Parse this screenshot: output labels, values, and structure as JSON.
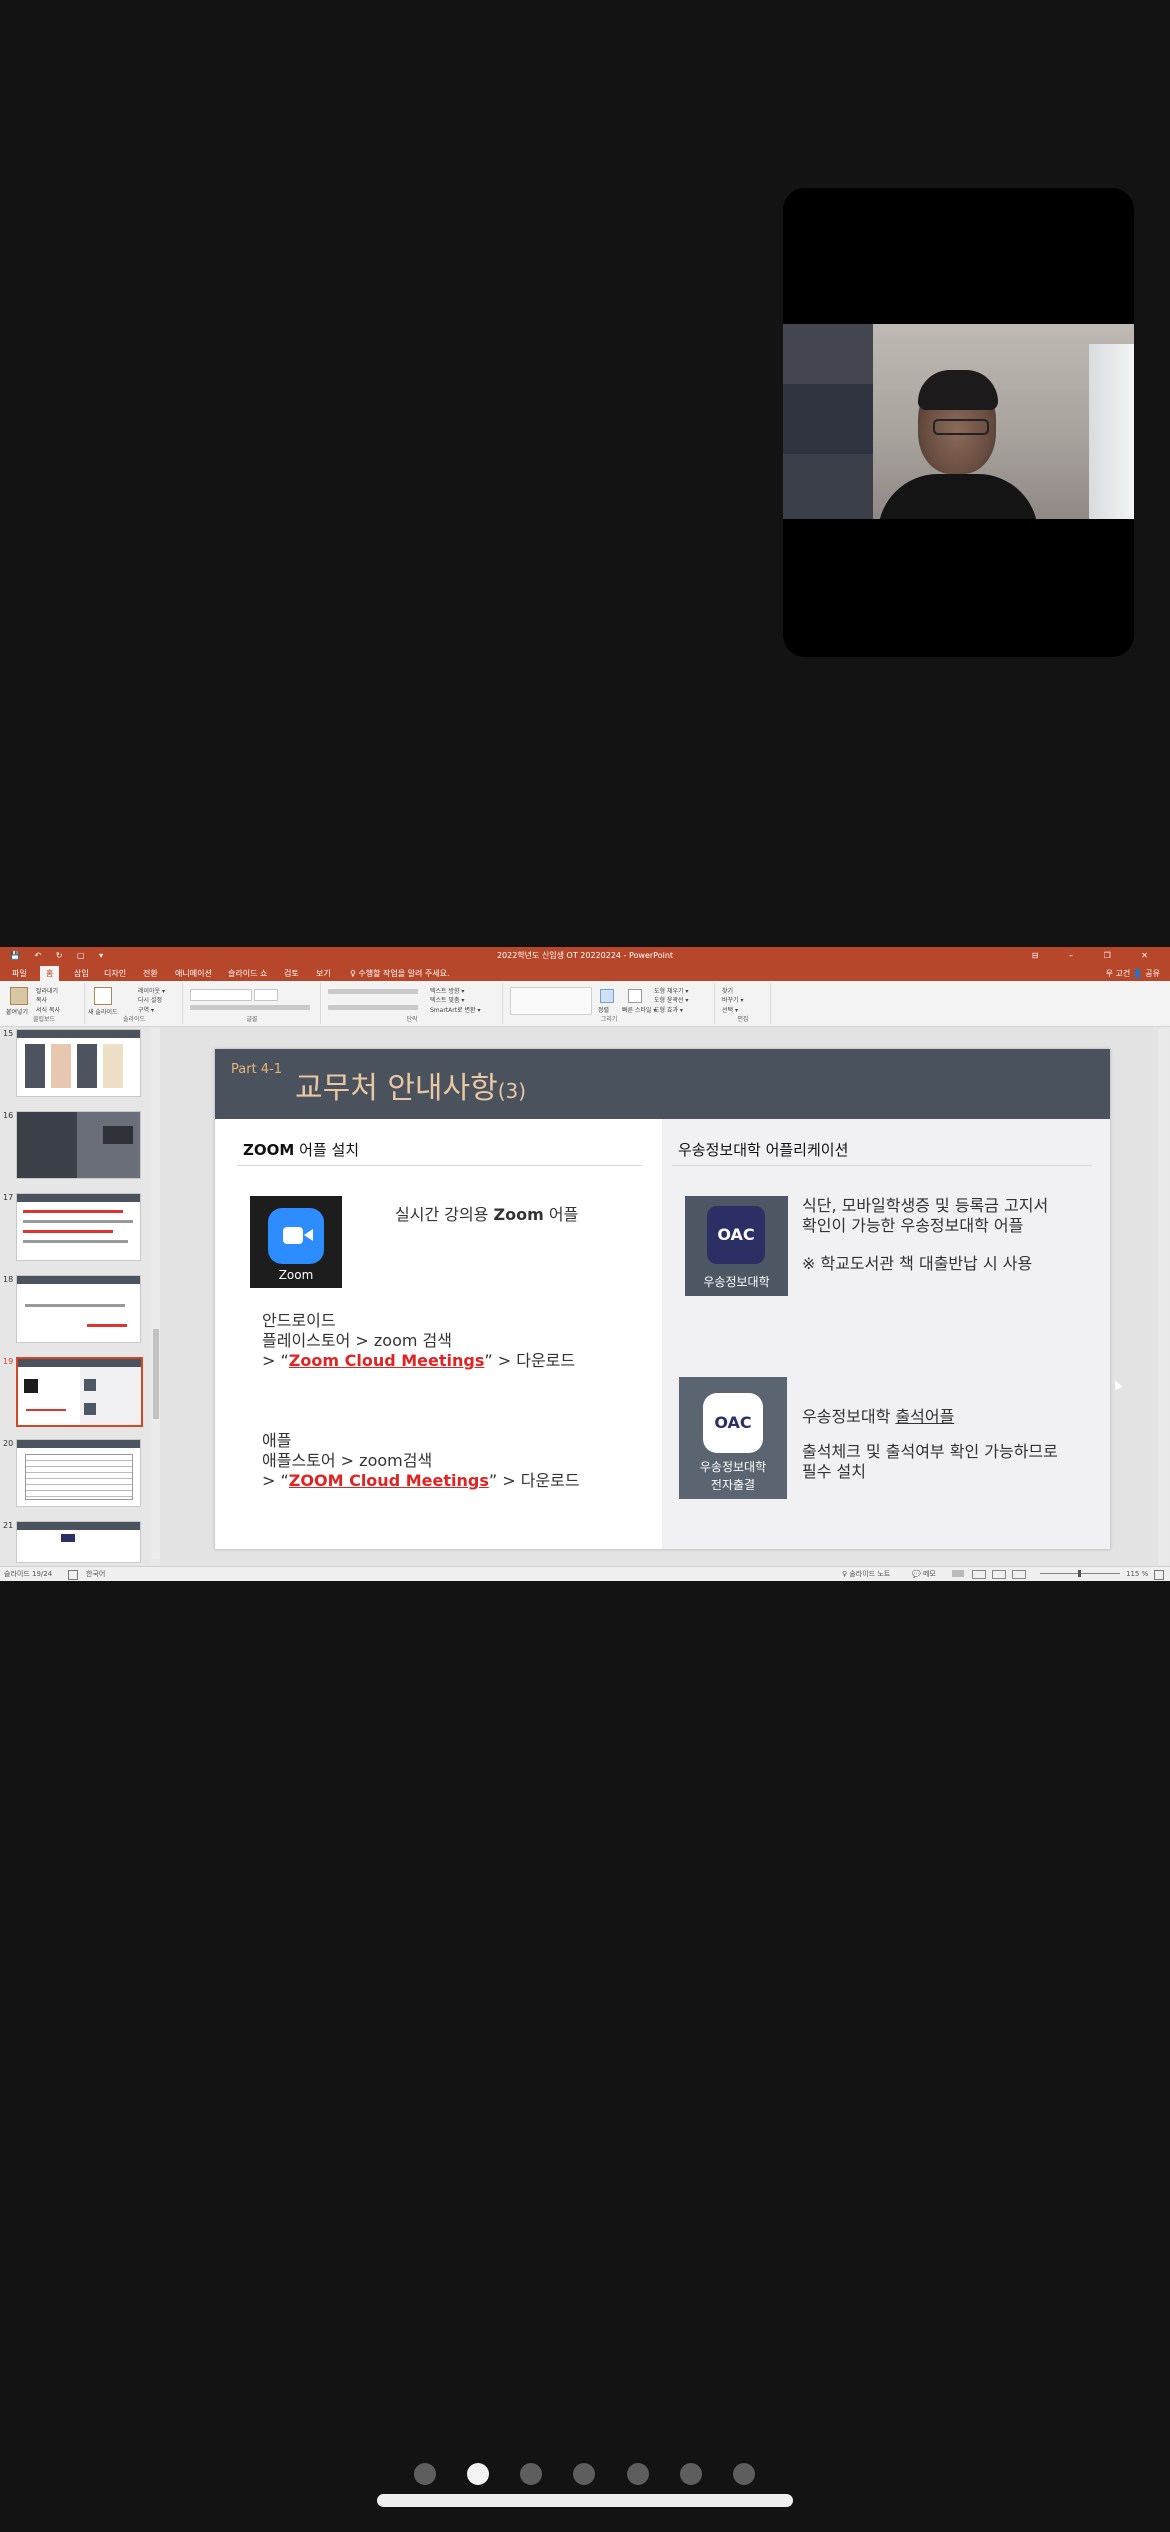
{
  "pager": {
    "count": 7,
    "active_index": 1
  },
  "window": {
    "title": "2022학년도 신입생 OT 20220224 - PowerPoint",
    "quick_access": "💾 ↶ ↻ ▢ ▾",
    "controls": "⊟ – ❐ ✕"
  },
  "ribbon": {
    "tabs": [
      "파일",
      "홈",
      "삽입",
      "디자인",
      "전환",
      "애니메이션",
      "슬라이드 쇼",
      "검토",
      "보기"
    ],
    "active_tab": "홈",
    "tell_me": "♀ 수행할 작업을 알려 주세요.",
    "user": "우 고건   👤 공유",
    "groups": [
      "클립보드",
      "슬라이드",
      "글꼴",
      "단락",
      "그리기",
      "편집"
    ],
    "clipboard_items": [
      "잘라내기",
      "복사",
      "서식 복사"
    ],
    "paste_label": "붙여넣기",
    "new_slide_label": "새 슬라이드",
    "slide_items": [
      "레이아웃 ▾",
      "다시 설정",
      "구역 ▾"
    ],
    "paragraph_items": [
      "텍스트 방향 ▾",
      "텍스트 맞춤 ▾",
      "SmartArt로 변환 ▾"
    ],
    "draw_items": [
      "정렬",
      "빠른 스타일 ▾"
    ],
    "shape_items": [
      "도형 채우기 ▾",
      "도형 윤곽선 ▾",
      "도형 효과 ▾"
    ],
    "edit_items": [
      "찾기",
      "바꾸기 ▾",
      "선택 ▾"
    ]
  },
  "thumbnails": [
    {
      "num": "15"
    },
    {
      "num": "16"
    },
    {
      "num": "17"
    },
    {
      "num": "18"
    },
    {
      "num": "19",
      "selected": true
    },
    {
      "num": "20"
    },
    {
      "num": "21"
    }
  ],
  "status": {
    "slide_counter": "슬라이드 19/24",
    "language": "한국어",
    "notes": "♀ 슬라이드 노트",
    "comments": "💬 메모",
    "zoom": "115 %"
  },
  "slide": {
    "part": "Part 4-1",
    "title": "교무처 안내사항",
    "title_suffix": "(3)",
    "left": {
      "heading_bold": "ZOOM",
      "heading_rest": " 어플 설치",
      "zoom_caption": "Zoom",
      "zoom_desc_1": "실시간 강의용 ",
      "zoom_desc_bold": "Zoom",
      "zoom_desc_2": " 어플",
      "android_title": "안드로이드",
      "android_line": "플레이스토어 > zoom 검색",
      "android_prefix": "> “",
      "android_link": "Zoom Cloud Meetings",
      "android_suffix": "” > 다운로드",
      "apple_title": "애플",
      "apple_line": "애플스토어 > zoom검색",
      "apple_prefix": "> “",
      "apple_link": "ZOOM Cloud Meetings",
      "apple_suffix": "” > 다운로드"
    },
    "right": {
      "heading": "우송정보대학 어플리케이션",
      "app1_logo": "OAC",
      "app1_caption": "우송정보대학",
      "app1_line1": "식단, 모바일학생증 및 등록금 고지서",
      "app1_line2": "확인이 가능한 우송정보대학 어플",
      "app1_note": "※ 학교도서관 책 대출반납 시 사용",
      "app2_logo": "OAC",
      "app2_caption_1": "우송정보대학",
      "app2_caption_2": "전자출결",
      "app2_title_1": "우송정보대학 ",
      "app2_title_link": "출석어플",
      "app2_line1": "출석체크 및 출석여부 확인 가능하므로",
      "app2_line2": "필수 설치"
    }
  },
  "colors": {
    "accent_powerpoint": "#b7472a",
    "slide_header": "#4a535d",
    "link_red": "#e02424",
    "zoom_blue": "#2d8cff"
  }
}
